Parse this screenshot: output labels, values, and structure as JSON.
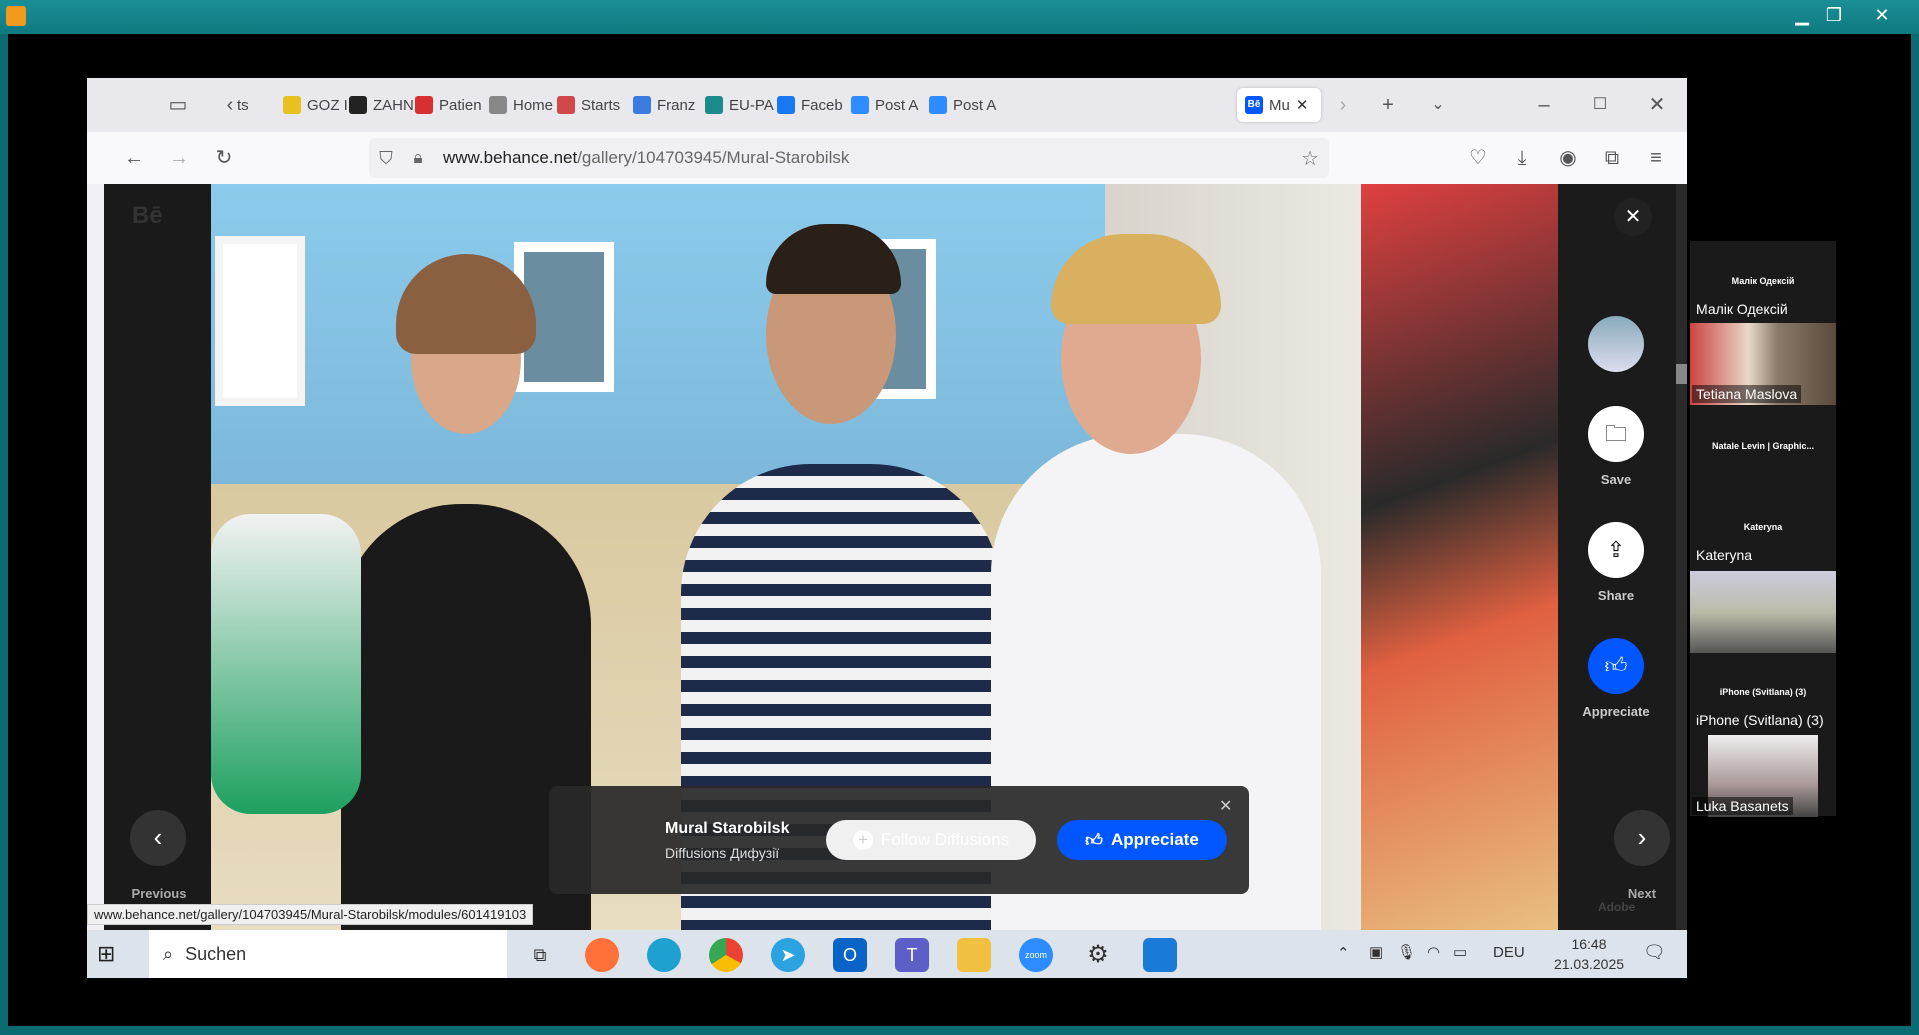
{
  "browser": {
    "tabs": [
      {
        "label": "ts",
        "color": "#999"
      },
      {
        "label": "GOZ I",
        "color": "#e8c020"
      },
      {
        "label": "ZAHN",
        "color": "#222"
      },
      {
        "label": "Patien",
        "color": "#d83030"
      },
      {
        "label": "Home",
        "color": "#888"
      },
      {
        "label": "Starts",
        "color": "#d04848"
      },
      {
        "label": "Franz",
        "color": "#3a7be0"
      },
      {
        "label": "EU-PA",
        "color": "#1a8a8a"
      },
      {
        "label": "Faceb",
        "color": "#1877f2"
      },
      {
        "label": "Post A",
        "color": "#2d8cff"
      },
      {
        "label": "Post A",
        "color": "#2d8cff"
      }
    ],
    "active_tab": {
      "label": "Mu",
      "favicon": "Bē"
    },
    "url_domain": "www.behance.net",
    "url_path": "/gallery/104703945/Mural-Starobilsk",
    "status_url": "www.behance.net/gallery/104703945/Mural-Starobilsk/modules/601419103"
  },
  "behance": {
    "logo": "Bē",
    "side_actions": [
      {
        "label": "Save",
        "icon": "folder-icon"
      },
      {
        "label": "Share",
        "icon": "share-icon"
      },
      {
        "label": "Appreciate",
        "icon": "thumbs-up-icon"
      }
    ],
    "previous_label": "Previous",
    "next_label": "Next",
    "adobe_label": "Adobe",
    "popup": {
      "title": "Mural Starobilsk",
      "owner": "Diffusions Дифузії",
      "follow_label": "Follow Diffusions",
      "appreciate_label": "Appreciate"
    },
    "accent": "#0057ff"
  },
  "taskbar": {
    "search_placeholder": "Suchen",
    "language": "DEU",
    "time": "16:48",
    "date": "21.03.2025"
  },
  "zoom_gallery": [
    {
      "small": "Малік Одексій",
      "name": "Малік Одексій"
    },
    {
      "name": "Tetiana Maslova",
      "video": true
    },
    {
      "small": "Natale Levin | Graphic..."
    },
    {
      "small": "Kateryna",
      "name": "Kateryna"
    },
    {
      "video": true
    },
    {
      "small": "iPhone (Svitlana) (3)",
      "name": "iPhone (Svitlana) (3)"
    },
    {
      "name": "Luka Basanets",
      "video": true
    }
  ]
}
